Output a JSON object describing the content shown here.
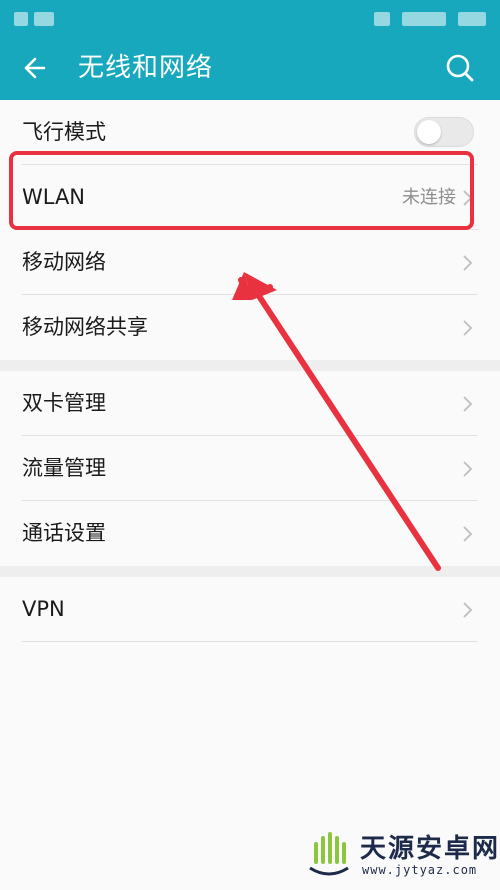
{
  "header": {
    "title": "无线和网络",
    "back_icon": "back-arrow-icon",
    "search_icon": "search-icon",
    "background": "#17a8bd"
  },
  "settings": {
    "airplane": {
      "label": "飞行模式",
      "toggle_on": false
    },
    "wlan": {
      "label": "WLAN",
      "value": "未连接"
    },
    "mobile_network": {
      "label": "移动网络"
    },
    "tethering": {
      "label": "移动网络共享"
    },
    "dual_sim": {
      "label": "双卡管理"
    },
    "data_usage": {
      "label": "流量管理"
    },
    "call_settings": {
      "label": "通话设置"
    },
    "vpn": {
      "label": "VPN"
    }
  },
  "annotation": {
    "highlight_color": "#e8323f"
  },
  "watermark": {
    "name": "天源安卓网",
    "url": "www.jytyaz.com"
  }
}
